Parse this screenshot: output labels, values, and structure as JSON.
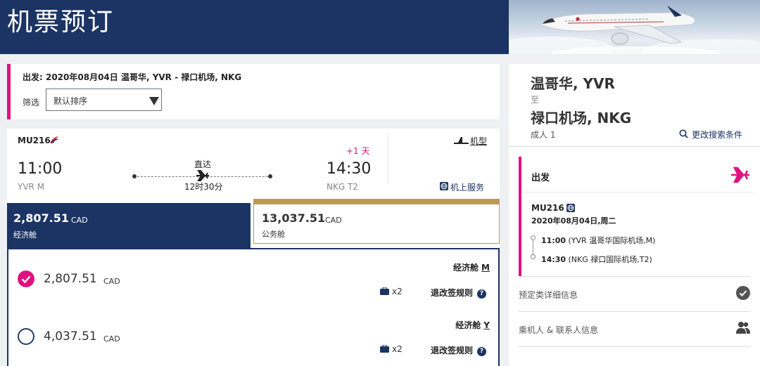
{
  "header": {
    "title": "机票预订"
  },
  "search_summary": {
    "route_text": "出发: 2020年08月04日 温哥华, YVR - 禄口机场, NKG",
    "filter_label": "筛选",
    "sort_value": "默认排序"
  },
  "flight": {
    "number": "MU216",
    "dep_time": "11:00",
    "dep_airport": "YVR M",
    "arr_time": "14:30",
    "arr_airport": "NKG T2",
    "plus_day": "+1 天",
    "stops": "直达",
    "duration": "12时30分",
    "aircraft_label": "机型",
    "onboard_label": "机上服务"
  },
  "fares": [
    {
      "price": "2,807.51",
      "currency": "CAD",
      "cabin": "经济舱",
      "selected": true
    },
    {
      "price": "13,037.51",
      "currency": "CAD",
      "cabin": "公务舱",
      "selected": false
    }
  ],
  "fare_options": [
    {
      "price": "2,807.51",
      "currency": "CAD",
      "cabin": "经济舱",
      "code": "M",
      "bags": "x2",
      "rules": "退改签规则",
      "selected": true
    },
    {
      "price": "4,037.51",
      "currency": "CAD",
      "cabin": "经济舱",
      "code": "Y",
      "bags": "x2",
      "rules": "退改签规则",
      "selected": false
    }
  ],
  "sidebar": {
    "from_city": "温哥华, YVR",
    "to_word": "至",
    "to_city": "禄口机场, NKG",
    "passengers": "成人 1",
    "modify": "更改搜索条件",
    "departure": {
      "heading": "出发",
      "flight_number": "MU216",
      "date": "2020年08月04日,周二",
      "dep_time": "11:00",
      "dep_place": "(YVR 温哥华国际机场,M)",
      "arr_time": "14:30",
      "arr_place": "(NKG 禄口国际机场,T2)"
    },
    "rows": [
      {
        "label": "预定类详细信息",
        "icon": "check-circle-icon"
      },
      {
        "label": "乘机人 & 联系人信息",
        "icon": "people-icon"
      }
    ]
  },
  "colors": {
    "navy": "#1c3464",
    "magenta": "#e0117f",
    "gold": "#b89a54"
  }
}
